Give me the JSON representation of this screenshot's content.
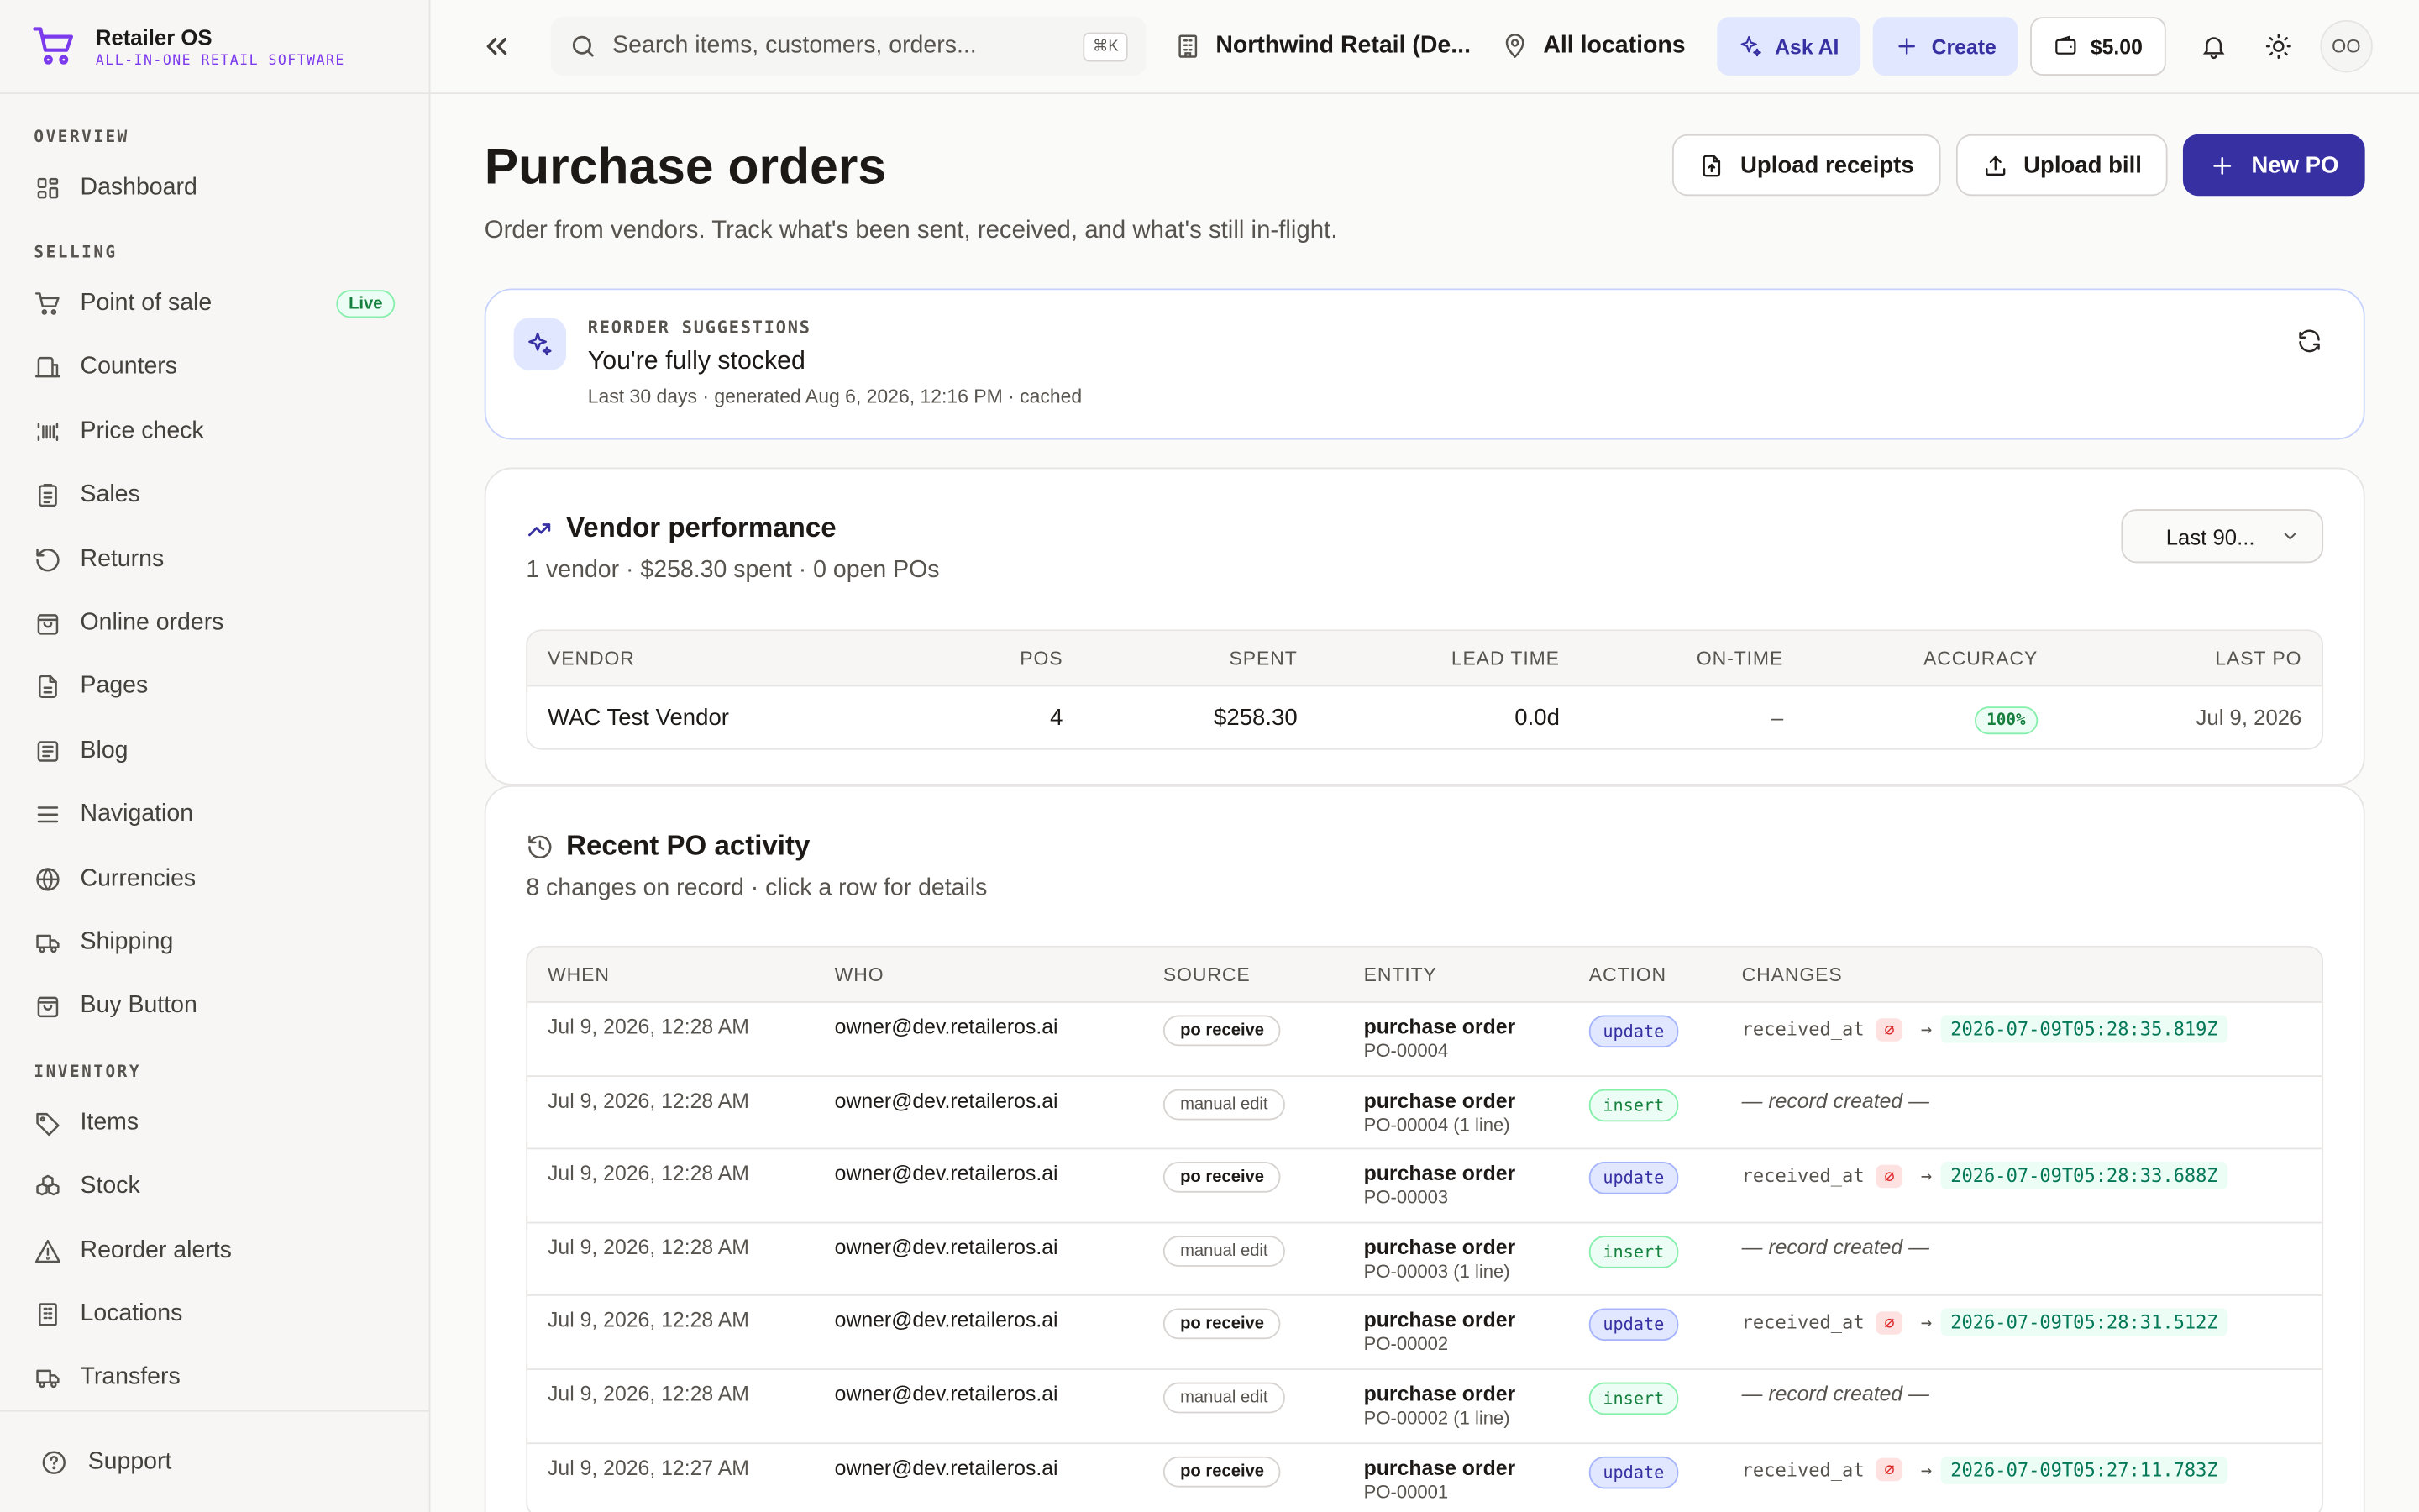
{
  "brand": {
    "name": "Retailer OS",
    "tagline": "ALL-IN-ONE RETAIL SOFTWARE"
  },
  "sidebar": {
    "sections": [
      {
        "title": "OVERVIEW",
        "items": [
          {
            "label": "Dashboard",
            "icon": "dashboard-icon"
          }
        ]
      },
      {
        "title": "SELLING",
        "items": [
          {
            "label": "Point of sale",
            "icon": "cart-icon",
            "badge": "Live"
          },
          {
            "label": "Counters",
            "icon": "counter-icon"
          },
          {
            "label": "Price check",
            "icon": "barcode-icon"
          },
          {
            "label": "Sales",
            "icon": "clipboard-icon"
          },
          {
            "label": "Returns",
            "icon": "return-icon"
          },
          {
            "label": "Online orders",
            "icon": "bag-icon"
          },
          {
            "label": "Pages",
            "icon": "page-icon"
          },
          {
            "label": "Blog",
            "icon": "blog-icon"
          },
          {
            "label": "Navigation",
            "icon": "menu-icon"
          },
          {
            "label": "Currencies",
            "icon": "globe-icon"
          },
          {
            "label": "Shipping",
            "icon": "truck-icon"
          },
          {
            "label": "Buy Button",
            "icon": "bag-icon"
          }
        ]
      },
      {
        "title": "INVENTORY",
        "items": [
          {
            "label": "Items",
            "icon": "tag-icon"
          },
          {
            "label": "Stock",
            "icon": "boxes-icon"
          },
          {
            "label": "Reorder alerts",
            "icon": "alert-icon"
          },
          {
            "label": "Locations",
            "icon": "building-icon"
          },
          {
            "label": "Transfers",
            "icon": "truck-icon"
          }
        ]
      }
    ],
    "support_label": "Support"
  },
  "topbar": {
    "search_placeholder": "Search items, customers, orders...",
    "search_shortcut": "⌘K",
    "org": "Northwind Retail (De...",
    "location": "All locations",
    "ask_ai": "Ask AI",
    "create": "Create",
    "credit": "$5.00",
    "avatar": "OO"
  },
  "page": {
    "title": "Purchase orders",
    "subtitle": "Order from vendors. Track what's been sent, received, and what's still in-flight.",
    "actions": {
      "upload_receipts": "Upload receipts",
      "upload_bill": "Upload bill",
      "new_po": "New PO"
    }
  },
  "reorder": {
    "eyebrow": "REORDER SUGGESTIONS",
    "title": "You're fully stocked",
    "meta": "Last 30 days · generated Aug 6, 2026, 12:16 PM · cached"
  },
  "vendor_perf": {
    "title": "Vendor performance",
    "subtitle": "1 vendor · $258.30 spent · 0 open POs",
    "range": "Last 90...",
    "columns": [
      "VENDOR",
      "POS",
      "SPENT",
      "LEAD TIME",
      "ON-TIME",
      "ACCURACY",
      "LAST PO"
    ],
    "rows": [
      {
        "vendor": "WAC Test Vendor",
        "pos": "4",
        "spent": "$258.30",
        "lead": "0.0d",
        "ontime": "–",
        "accuracy": "100%",
        "last": "Jul 9, 2026"
      }
    ]
  },
  "activity": {
    "title": "Recent PO activity",
    "subtitle": "8 changes on record · click a row for details",
    "columns": [
      "WHEN",
      "WHO",
      "SOURCE",
      "ENTITY",
      "ACTION",
      "CHANGES"
    ],
    "null_symbol": "∅",
    "created_text": "— record created —",
    "rows": [
      {
        "when": "Jul 9, 2026, 12:28 AM",
        "who": "owner@dev.retaileros.ai",
        "source": "po receive",
        "source_kind": "receive",
        "entity": "purchase order",
        "entity_id": "PO-00004",
        "action": "update",
        "field": "received_at",
        "new_value": "2026-07-09T05:28:35.819Z"
      },
      {
        "when": "Jul 9, 2026, 12:28 AM",
        "who": "owner@dev.retaileros.ai",
        "source": "manual edit",
        "source_kind": "manual",
        "entity": "purchase order",
        "entity_id": "PO-00004 (1 line)",
        "action": "insert"
      },
      {
        "when": "Jul 9, 2026, 12:28 AM",
        "who": "owner@dev.retaileros.ai",
        "source": "po receive",
        "source_kind": "receive",
        "entity": "purchase order",
        "entity_id": "PO-00003",
        "action": "update",
        "field": "received_at",
        "new_value": "2026-07-09T05:28:33.688Z"
      },
      {
        "when": "Jul 9, 2026, 12:28 AM",
        "who": "owner@dev.retaileros.ai",
        "source": "manual edit",
        "source_kind": "manual",
        "entity": "purchase order",
        "entity_id": "PO-00003 (1 line)",
        "action": "insert"
      },
      {
        "when": "Jul 9, 2026, 12:28 AM",
        "who": "owner@dev.retaileros.ai",
        "source": "po receive",
        "source_kind": "receive",
        "entity": "purchase order",
        "entity_id": "PO-00002",
        "action": "update",
        "field": "received_at",
        "new_value": "2026-07-09T05:28:31.512Z"
      },
      {
        "when": "Jul 9, 2026, 12:28 AM",
        "who": "owner@dev.retaileros.ai",
        "source": "manual edit",
        "source_kind": "manual",
        "entity": "purchase order",
        "entity_id": "PO-00002 (1 line)",
        "action": "insert"
      },
      {
        "when": "Jul 9, 2026, 12:27 AM",
        "who": "owner@dev.retaileros.ai",
        "source": "po receive",
        "source_kind": "receive",
        "entity": "purchase order",
        "entity_id": "PO-00001",
        "action": "update",
        "field": "received_at",
        "new_value": "2026-07-09T05:27:11.783Z"
      }
    ]
  },
  "colors": {
    "accent": "#3730a3",
    "brand": "#7c3aed",
    "success": "#15803d",
    "danger": "#dc2626"
  }
}
